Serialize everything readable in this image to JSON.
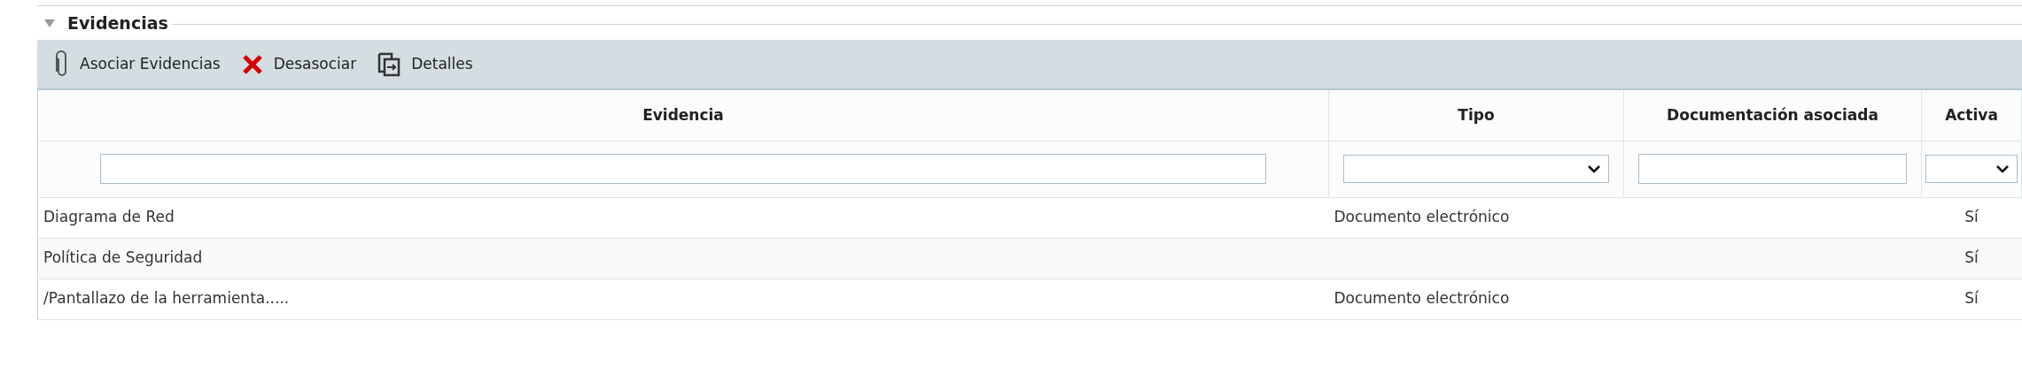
{
  "section": {
    "title": "Evidencias",
    "expanded": true
  },
  "toolbar": [
    {
      "kind": "attach",
      "label": "Asociar Evidencias"
    },
    {
      "kind": "remove",
      "label": "Desasociar"
    },
    {
      "kind": "details",
      "label": "Detalles"
    }
  ],
  "table": {
    "columns": [
      {
        "label": "Evidencia",
        "kind": "text"
      },
      {
        "label": "Tipo",
        "kind": "select"
      },
      {
        "label": "Documentación asociada",
        "kind": "text"
      },
      {
        "label": "Activa",
        "kind": "select"
      }
    ],
    "rows": [
      [
        "Diagrama de Red",
        "Documento electrónico",
        null,
        "Sí"
      ],
      [
        "Política de Seguridad",
        null,
        null,
        "Sí"
      ],
      [
        "/Pantallazo de la herramienta.....",
        "Documento electrónico",
        null,
        "Sí"
      ]
    ]
  }
}
